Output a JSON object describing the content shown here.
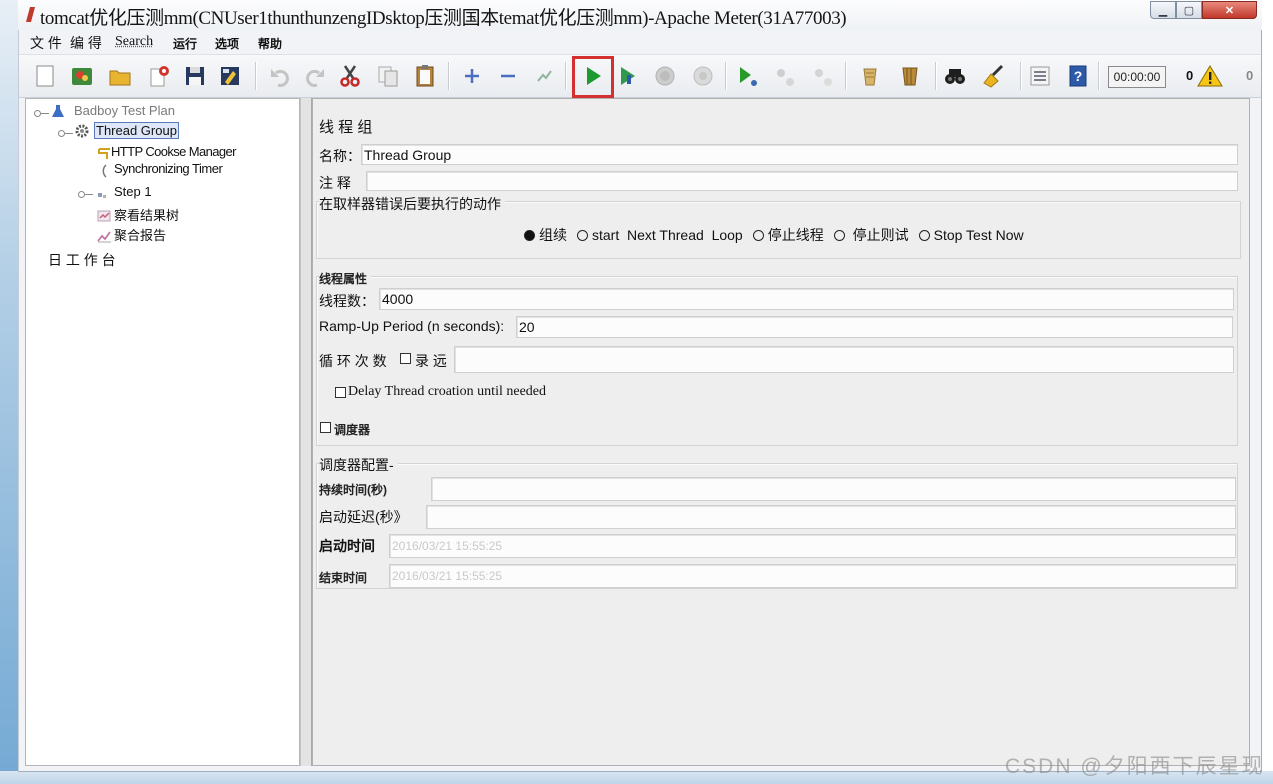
{
  "window": {
    "title": "tomcat优化压测mm(CNUser1thunthunzengIDsktop压测国本temat优化压测mm)-Apache Meter(31A77003)",
    "controls": [
      "minimize-icon",
      "maximize-icon",
      "close-icon"
    ]
  },
  "menu": {
    "items": [
      {
        "label": "文 件"
      },
      {
        "label": "编 得"
      },
      {
        "label": "Search"
      },
      {
        "label": "运行"
      },
      {
        "label": "选项"
      },
      {
        "label": "帮助"
      }
    ]
  },
  "toolbar": {
    "buttons": [
      "new-icon",
      "templates-icon",
      "open-icon",
      "close-plan-icon",
      "save-icon",
      "save-screenshot-icon",
      "undo-icon",
      "redo-icon",
      "cut-icon",
      "copy-icon",
      "paste-icon",
      "expand-icon",
      "collapse-icon",
      "toggle-icon",
      "start-icon",
      "start-no-pauses-icon",
      "stop-icon",
      "shutdown-icon",
      "remote-start-all-icon",
      "remote-stop-all-icon",
      "remote-shutdown-all-icon",
      "clear-icon",
      "clear-all-icon",
      "search-icon",
      "reset-search-icon",
      "function-helper-icon",
      "help-icon"
    ],
    "highlighted_button": "start-icon",
    "timer": "00:00:00",
    "warning_count": "0",
    "thread_count": "0"
  },
  "tree": {
    "nodes": [
      {
        "label": "Badboy Test Plan",
        "icon": "test-plan-icon",
        "expanded": true
      },
      {
        "label": "Thread Group",
        "icon": "thread-group-icon",
        "expanded": true,
        "selected": true
      },
      {
        "label": "HTTP Cookse Manager",
        "icon": "cookie-manager-icon"
      },
      {
        "label": "Synchronizing Timer",
        "icon": "timer-icon"
      },
      {
        "label": "Step 1",
        "icon": "step-icon",
        "expanded": false
      },
      {
        "label": "察看结果树",
        "icon": "results-tree-icon"
      },
      {
        "label": "聚合报告",
        "icon": "aggregate-report-icon"
      },
      {
        "label": "日 工 作 台",
        "icon": "workbench-icon"
      }
    ]
  },
  "editor": {
    "title": "线 程 组",
    "name_label": "名称：",
    "name_value": "Thread Group",
    "comment_label": "注 释",
    "comment_value": "",
    "error_action": {
      "label": "在取样器错误后要执行的动作",
      "options": [
        {
          "label": "组续",
          "selected": true
        },
        {
          "label": "start  Next Thread  Loop",
          "selected": false
        },
        {
          "label": "停止线程",
          "selected": false
        },
        {
          "label": " 停止则试",
          "selected": false
        },
        {
          "label": "Stop Test Now",
          "selected": false
        }
      ]
    },
    "thread_properties": {
      "label": "线程属性",
      "threads_label": "线程数：",
      "threads_value": "4000",
      "rampup_label": "Ramp-Up Period (n seconds):",
      "rampup_value": "20",
      "loop_label": "循 环 次 数",
      "loop_forever_label": "录 远",
      "loop_forever_checked": false,
      "loop_value": "",
      "delay_label": "Delay Thread croation until needed",
      "delay_checked": false,
      "scheduler_label": "调度器",
      "scheduler_checked": false
    },
    "scheduler_config": {
      "label": "调度器配置-",
      "duration_label": "持续时间(秒)",
      "duration_value": "",
      "startup_delay_label": "启动延迟(秒》",
      "startup_delay_value": "",
      "start_time_label": "启动时间",
      "start_time_value": "2016/03/21 15:55:25",
      "end_time_label": "结束时间",
      "end_time_value": "2016/03/21 15:55:25"
    }
  },
  "watermark": "CSDN @夕阳西下辰星现",
  "colors": {
    "highlight": "#d3302f",
    "start_green": "#1e9a2e",
    "panel_bg": "#eeeeee",
    "tree_bg": "#ffffff",
    "selection": "#dde7f7"
  }
}
